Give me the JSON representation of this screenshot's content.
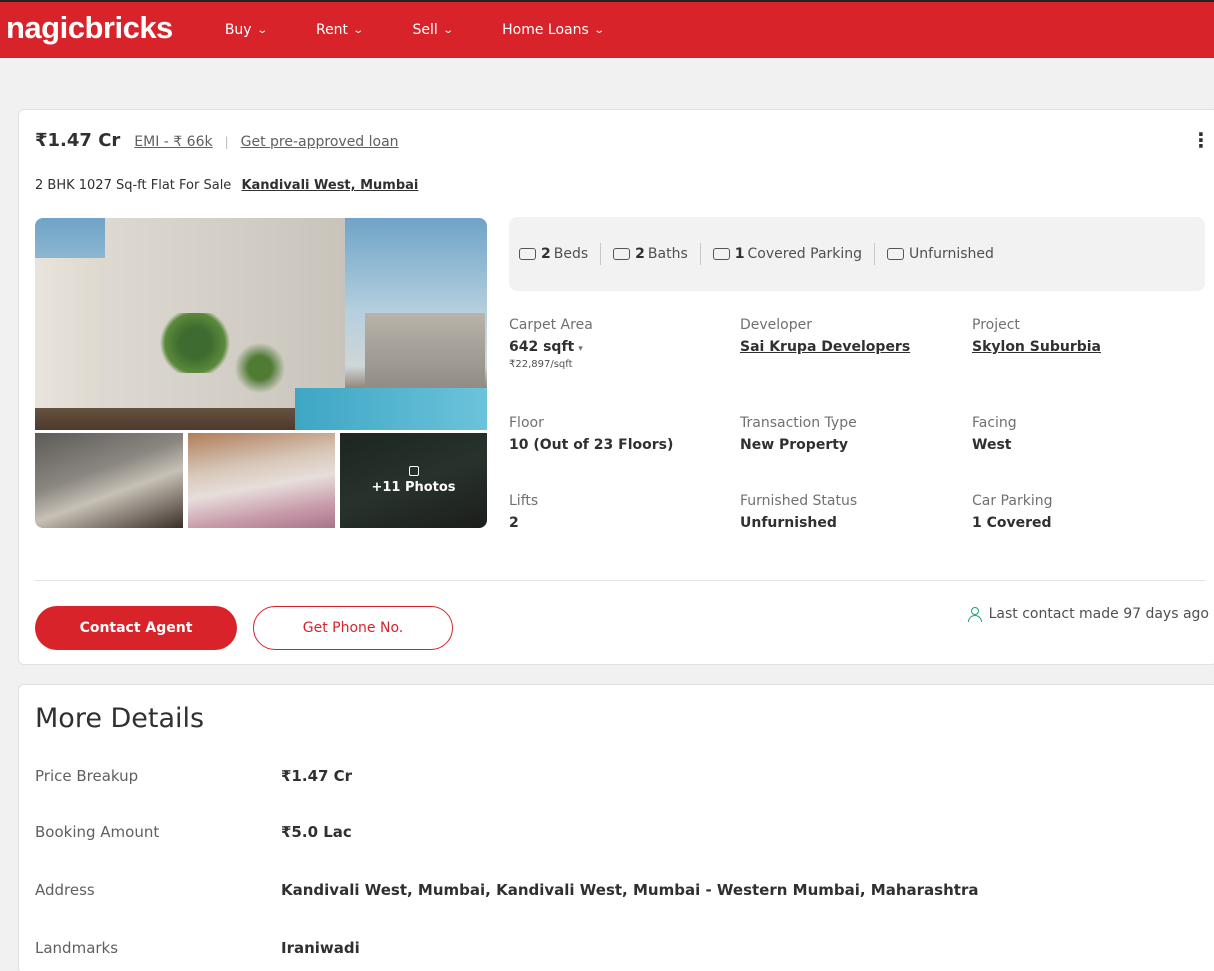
{
  "brand": {
    "logo": "nagicbricks",
    "accent": "#d8232a"
  },
  "nav": {
    "items": [
      {
        "label": "Buy"
      },
      {
        "label": "Rent"
      },
      {
        "label": "Sell"
      },
      {
        "label": "Home Loans"
      }
    ]
  },
  "listing": {
    "price": "₹1.47 Cr",
    "emi": "EMI - ₹ 66k",
    "loan_link": "Get pre-approved loan",
    "title": "2 BHK 1027 Sq-ft Flat For Sale",
    "locality": "Kandivali West, Mumbai",
    "photos_more": "+11 Photos",
    "chips": [
      {
        "icon": "bed-icon",
        "value": "2",
        "label": "Beds"
      },
      {
        "icon": "bath-icon",
        "value": "2",
        "label": "Baths"
      },
      {
        "icon": "car-icon",
        "value": "1",
        "label": "Covered Parking"
      },
      {
        "icon": "furniture-icon",
        "value": "",
        "label": "Unfurnished"
      }
    ],
    "specs": {
      "carpet_area": {
        "label": "Carpet Area",
        "value": "642 sqft",
        "sub": "₹22,897/sqft"
      },
      "developer": {
        "label": "Developer",
        "value": "Sai Krupa Developers"
      },
      "project": {
        "label": "Project",
        "value": "Skylon Suburbia"
      },
      "floor": {
        "label": "Floor",
        "value": "10 (Out of 23 Floors)"
      },
      "transaction": {
        "label": "Transaction Type",
        "value": "New Property"
      },
      "facing": {
        "label": "Facing",
        "value": "West"
      },
      "lifts": {
        "label": "Lifts",
        "value": "2"
      },
      "furnished": {
        "label": "Furnished Status",
        "value": "Unfurnished"
      },
      "car_parking": {
        "label": "Car Parking",
        "value": "1 Covered"
      }
    },
    "contact_button": "Contact Agent",
    "phone_button": "Get Phone No.",
    "last_contact": "Last contact made 97 days ago"
  },
  "more_details": {
    "heading": "More Details",
    "rows": [
      {
        "label": "Price Breakup",
        "value": "₹1.47 Cr"
      },
      {
        "label": "Booking Amount",
        "value": "₹5.0 Lac"
      },
      {
        "label": "Address",
        "value": "Kandivali West, Mumbai, Kandivali West, Mumbai - Western Mumbai, Maharashtra"
      },
      {
        "label": "Landmarks",
        "value": "Iraniwadi"
      }
    ]
  }
}
